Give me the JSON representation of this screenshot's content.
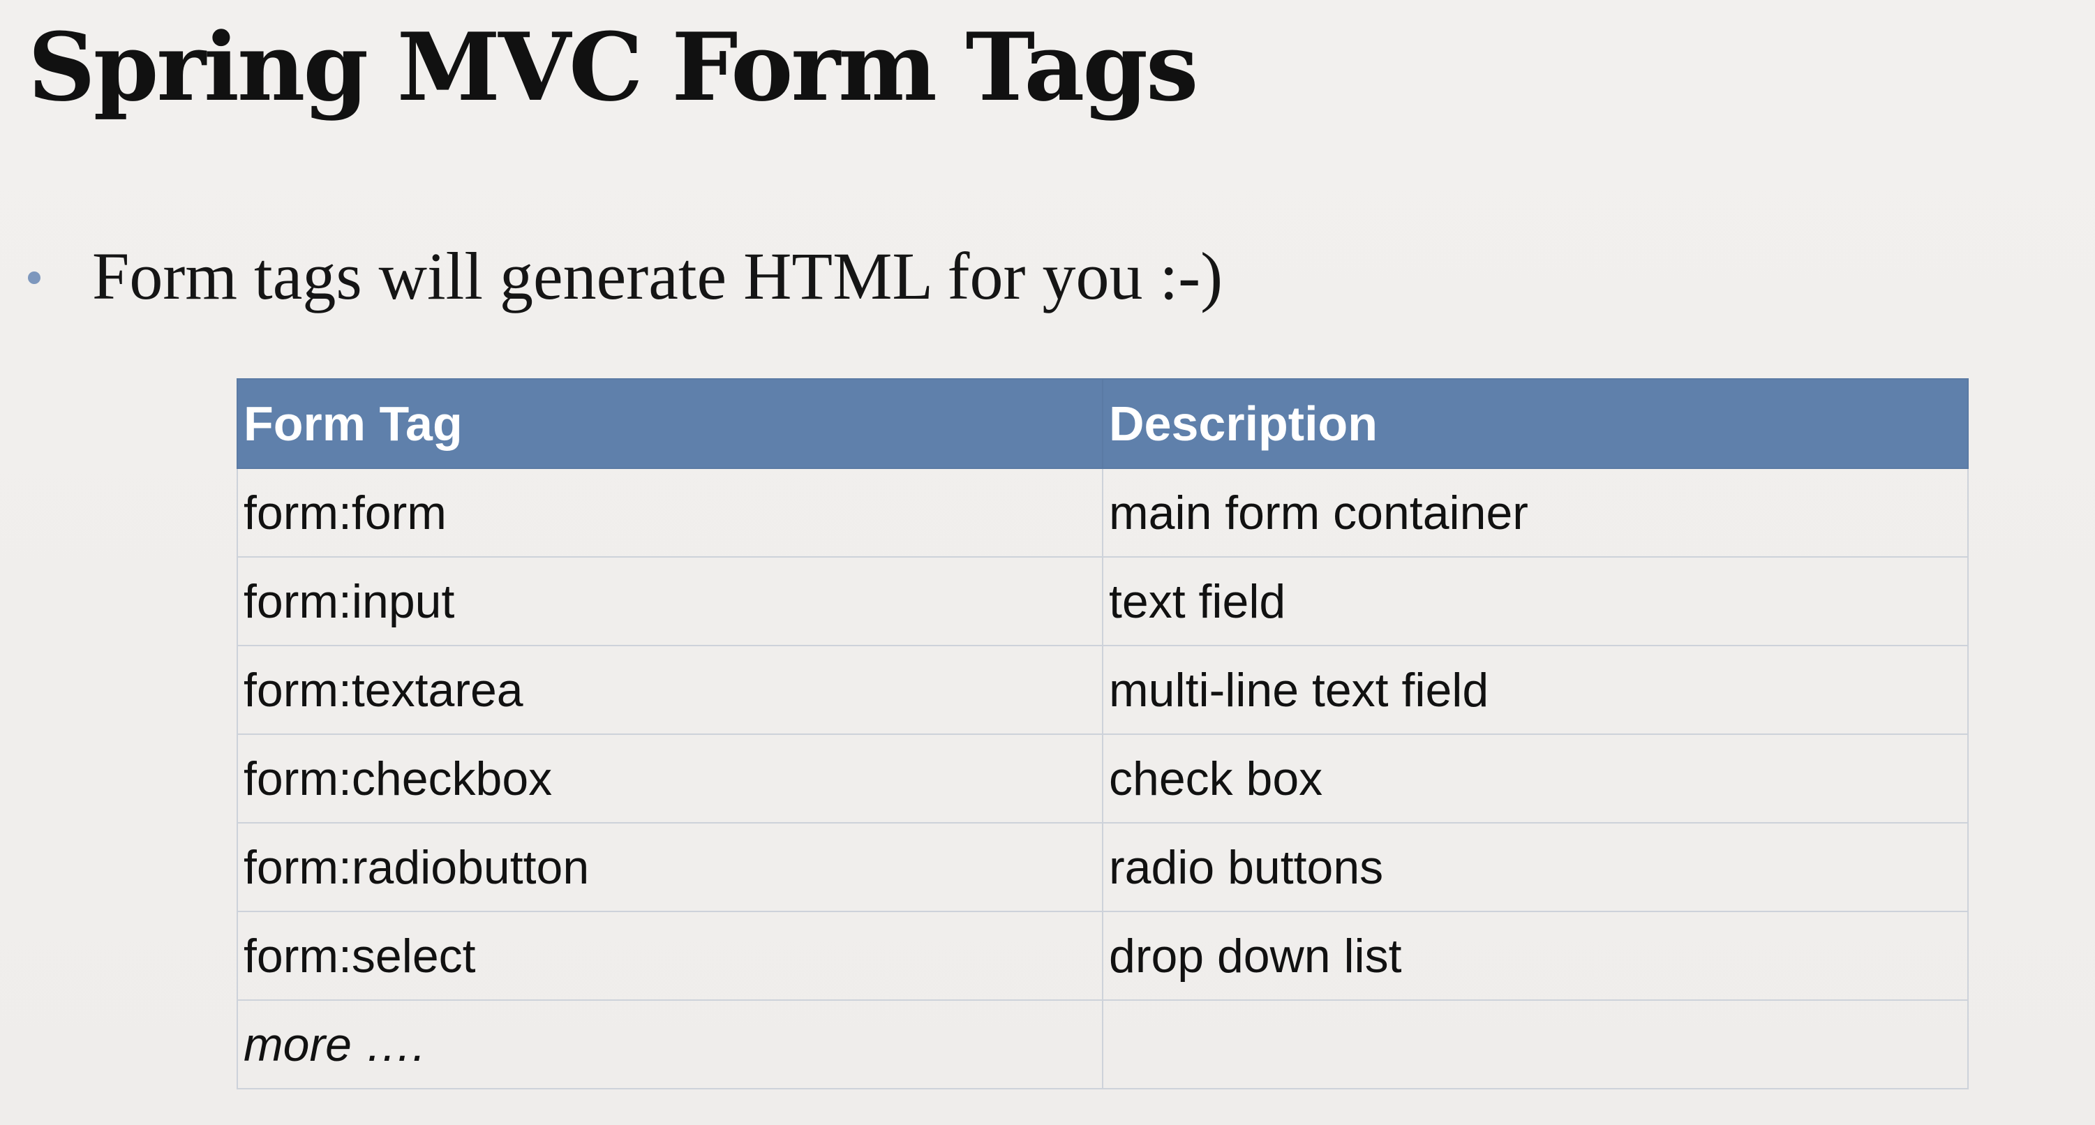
{
  "slide": {
    "title": "Spring MVC Form Tags",
    "bullet": "Form tags will generate HTML for you :-)",
    "colors": {
      "header_bg": "#5f80ab",
      "header_text": "#ffffff",
      "bullet_dot": "#7d97bd",
      "background": "#f0eeec"
    }
  },
  "table": {
    "headers": [
      "Form Tag",
      "Description"
    ],
    "rows": [
      [
        "form:form",
        "main form container"
      ],
      [
        "form:input",
        "text field"
      ],
      [
        "form:textarea",
        "multi-line text field"
      ],
      [
        "form:checkbox",
        "check box"
      ],
      [
        "form:radiobutton",
        "radio buttons"
      ],
      [
        "form:select",
        "drop down list"
      ],
      [
        "more ….",
        ""
      ]
    ]
  }
}
